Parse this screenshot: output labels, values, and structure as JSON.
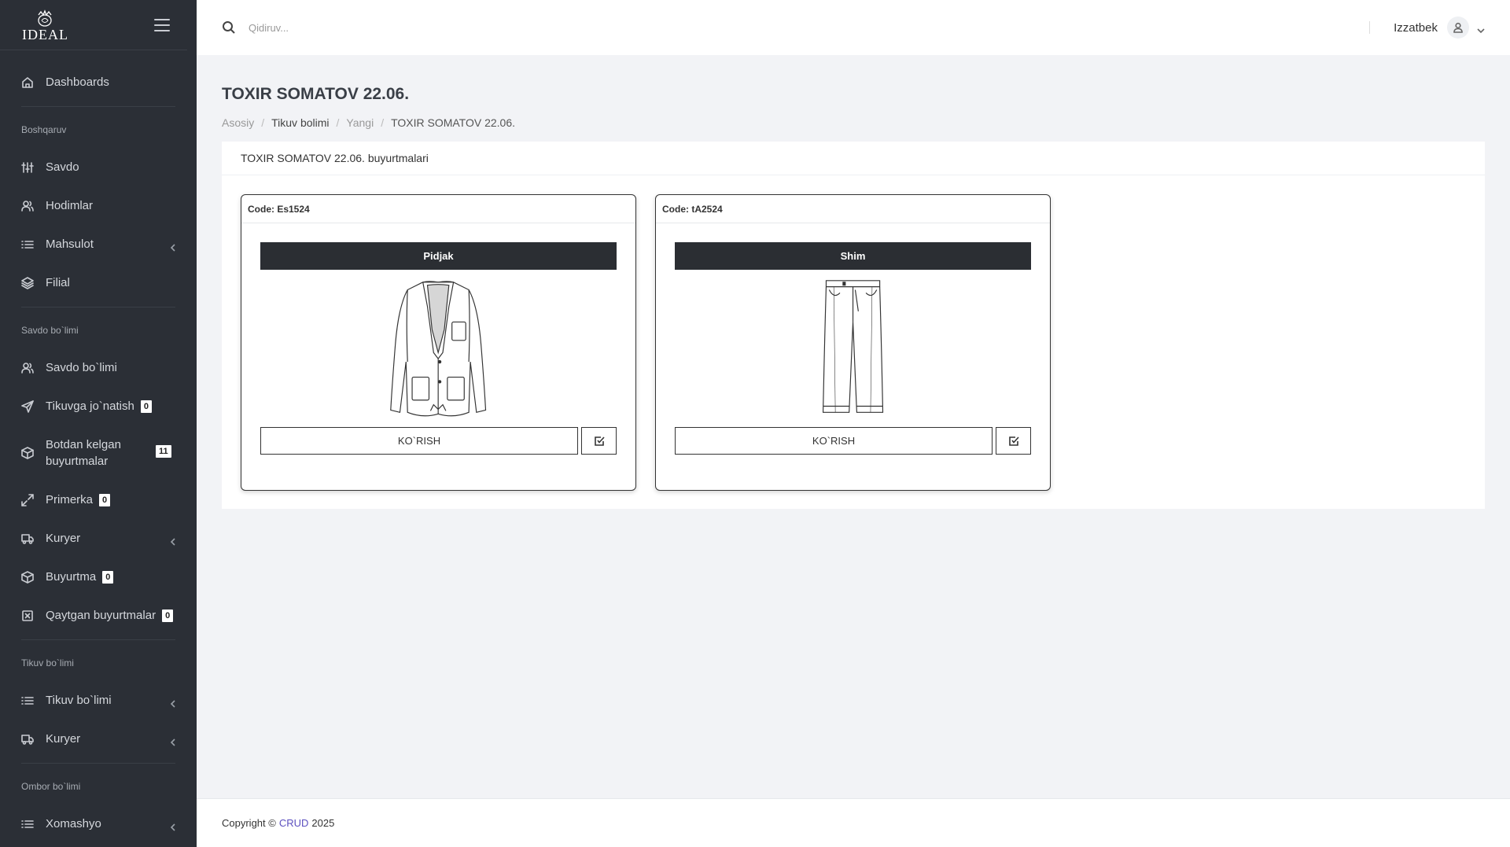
{
  "sidebar": {
    "logo_text": "IDEAL",
    "items_top": [
      {
        "label": "Dashboards",
        "icon": "home-icon"
      }
    ],
    "sections": [
      {
        "title": "Boshqaruv",
        "items": [
          {
            "label": "Savdo",
            "icon": "sliders-icon"
          },
          {
            "label": "Hodimlar",
            "icon": "users-icon"
          },
          {
            "label": "Mahsulot",
            "icon": "list-icon",
            "chevron": true
          },
          {
            "label": "Filial",
            "icon": "layers-icon"
          }
        ]
      },
      {
        "title": "Savdo bo`limi",
        "items": [
          {
            "label": "Savdo bo`limi",
            "icon": "users-icon"
          },
          {
            "label": "Tikuvga jo`natish",
            "icon": "send-icon",
            "badge": "0"
          },
          {
            "label": "Botdan kelgan buyurtmalar",
            "icon": "box-icon",
            "badge": "11"
          },
          {
            "label": "Primerka",
            "icon": "maximize-icon",
            "badge": "0"
          },
          {
            "label": "Kuryer",
            "icon": "truck-icon",
            "chevron": true
          },
          {
            "label": "Buyurtma",
            "icon": "box-icon",
            "badge": "0"
          },
          {
            "label": "Qaytgan buyurtmalar",
            "icon": "x-square-icon",
            "badge": "0"
          }
        ]
      },
      {
        "title": "Tikuv bo`limi",
        "items": [
          {
            "label": "Tikuv bo`limi",
            "icon": "list-icon",
            "chevron": true
          },
          {
            "label": "Kuryer",
            "icon": "truck-icon",
            "chevron": true
          }
        ]
      },
      {
        "title": "Ombor bo`limi",
        "items": [
          {
            "label": "Xomashyo",
            "icon": "list-icon",
            "chevron": true
          }
        ]
      }
    ]
  },
  "topbar": {
    "search_placeholder": "Qidiruv...",
    "username": "Izzatbek"
  },
  "page": {
    "title": "TOXIR SOMATOV 22.06.",
    "breadcrumb": [
      "Asosiy",
      "Tikuv bolimi",
      "Yangi",
      "TOXIR SOMATOV 22.06."
    ],
    "card_title": "TOXIR SOMATOV 22.06. buyurtmalari",
    "items": [
      {
        "code": "Code: Es1524",
        "name": "Pidjak",
        "image": "jacket-illustration",
        "button": "KO`RISH"
      },
      {
        "code": "Code: tA2524",
        "name": "Shim",
        "image": "trousers-illustration",
        "button": "KO`RISH"
      }
    ]
  },
  "footer": {
    "prefix": "Copyright ©",
    "brand": "CRUD",
    "year": "2025"
  },
  "colors": {
    "sidebar_bg": "#2b2f36",
    "page_bg": "#f2f3f6",
    "title_bar": "#2b2e33",
    "brand_link": "#5b4fbf"
  }
}
